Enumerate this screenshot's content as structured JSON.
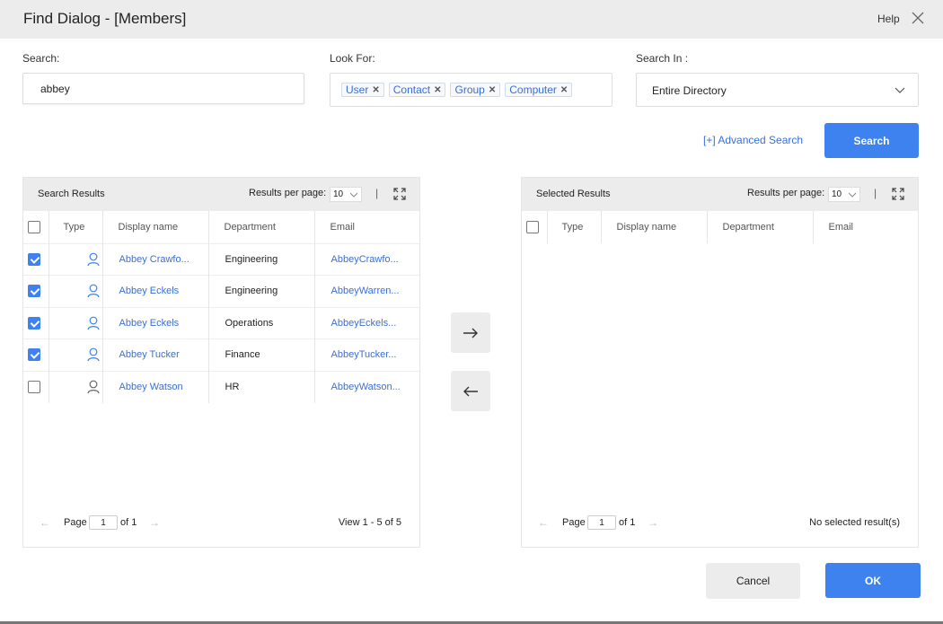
{
  "dialog": {
    "title": "Find Dialog - [Members]",
    "help_label": "Help"
  },
  "search": {
    "label": "Search:",
    "value": "abbey"
  },
  "look_for": {
    "label": "Look For:",
    "chips": [
      "User",
      "Contact",
      "Group",
      "Computer"
    ]
  },
  "search_in": {
    "label": "Search In :",
    "selected": "Entire Directory"
  },
  "actions": {
    "advanced_search": "[+] Advanced Search",
    "search": "Search",
    "cancel": "Cancel",
    "ok": "OK"
  },
  "search_results": {
    "title": "Search Results",
    "results_per_page_label": "Results per page:",
    "results_per_page": "10",
    "separator": "|",
    "columns": [
      "Type",
      "Display name",
      "Department",
      "Email"
    ],
    "rows": [
      {
        "checked": true,
        "display_name": "Abbey Crawfo...",
        "department": "Engineering",
        "email": "AbbeyCrawfo..."
      },
      {
        "checked": true,
        "display_name": "Abbey Eckels",
        "department": "Engineering",
        "email": "AbbeyWarren..."
      },
      {
        "checked": true,
        "display_name": "Abbey Eckels",
        "department": "Operations",
        "email": "AbbeyEckels..."
      },
      {
        "checked": true,
        "display_name": "Abbey Tucker",
        "department": "Finance",
        "email": "AbbeyTucker..."
      },
      {
        "checked": false,
        "display_name": "Abbey Watson",
        "department": "HR",
        "email": "AbbeyWatson..."
      }
    ],
    "pager": {
      "page_label": "Page",
      "page": "1",
      "of_label": "of 1",
      "status": "View 1 - 5 of 5"
    }
  },
  "selected_results": {
    "title": "Selected Results",
    "results_per_page_label": "Results per page:",
    "results_per_page": "10",
    "separator": "|",
    "columns": [
      "Type",
      "Display name",
      "Department",
      "Email"
    ],
    "rows": [],
    "pager": {
      "page_label": "Page",
      "page": "1",
      "of_label": "of 1",
      "status": "No selected result(s)"
    }
  },
  "colors": {
    "accent": "#3d82ee",
    "link": "#3a6fd8",
    "header_bg": "#ececec"
  }
}
